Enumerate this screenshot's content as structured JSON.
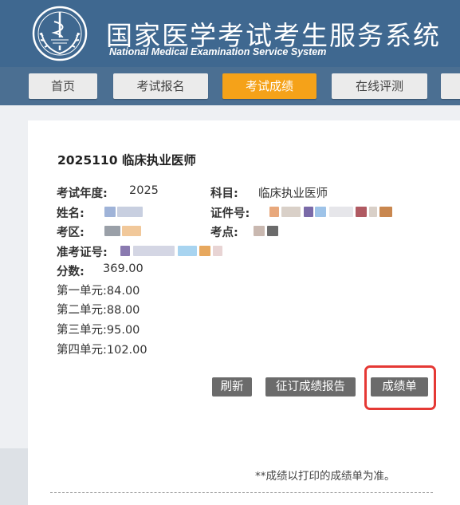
{
  "header": {
    "title_cn": "国家医学考试考生服务系统",
    "title_en": "National Medical Examination Service System",
    "logo_icon": "medical-caduceus-emblem-icon"
  },
  "nav": {
    "tabs": [
      {
        "label": "首页"
      },
      {
        "label": "考试报名"
      },
      {
        "label": "考试成绩",
        "active": true
      },
      {
        "label": "在线评测"
      }
    ]
  },
  "result": {
    "title": "2025110  临床执业医师",
    "year_label": "考试年度:",
    "year_value": "2025",
    "subject_label": "科目:",
    "subject_value": "临床执业医师",
    "name_label": "姓名:",
    "id_label": "证件号:",
    "region_label": "考区:",
    "site_label": "考点:",
    "ticket_label": "准考证号:",
    "score_label": "分数:",
    "score_value": "369.00",
    "units": [
      {
        "text": "第一单元:84.00"
      },
      {
        "text": "第二单元:88.00"
      },
      {
        "text": "第三单元:95.00"
      },
      {
        "text": "第四单元:102.00"
      }
    ],
    "buttons": {
      "refresh": "刷新",
      "order_report": "征订成绩报告",
      "score_sheet": "成绩单"
    },
    "note": "**成绩以打印的成绩单为准。"
  },
  "colors": {
    "header_bg": "#3f6890",
    "nav_bg": "#4b6f92",
    "active_tab": "#f5a219",
    "button_bg": "#6b6b6b",
    "highlight": "#e53935"
  }
}
